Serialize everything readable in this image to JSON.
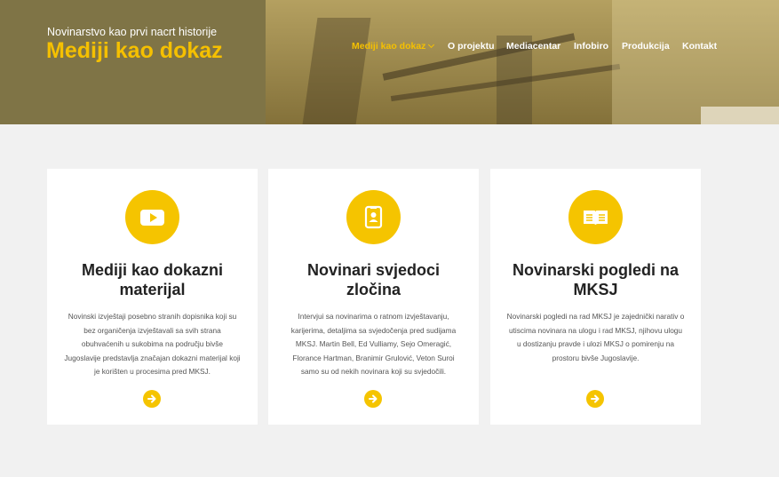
{
  "header": {
    "tagline": "Novinarstvo kao prvi nacrt historije",
    "title": "Mediji kao dokaz"
  },
  "nav": {
    "items": [
      {
        "label": "Mediji kao dokaz",
        "active": true,
        "has_dropdown": true
      },
      {
        "label": "O projektu"
      },
      {
        "label": "Mediacentar"
      },
      {
        "label": "Infobiro"
      },
      {
        "label": "Produkcija"
      },
      {
        "label": "Kontakt"
      }
    ]
  },
  "colors": {
    "accent": "#f5c400",
    "background": "#f1f1f1",
    "card": "#ffffff"
  },
  "cards": [
    {
      "icon": "video-play-icon",
      "title": "Mediji kao dokazni materijal",
      "text": "Novinski izvještaji posebno stranih dopisnika koji su bez organičenja izvještavali sa svih strana obuhvaćenih u sukobima na području bivše Jugoslavije predstavlja značajan dokazni materijal koji je korišten u procesima pred MKSJ."
    },
    {
      "icon": "id-badge-icon",
      "title": "Novinari svjedoci zločina",
      "text": "Intervjui sa novinarima o ratnom izvještavanju, karijerima, detaljima sa svjedočenja pred sudijama MKSJ. Martin Bell, Ed Vulliamy, Sejo Omeragić, Florance Hartman, Branimir Grulović, Veton Suroi samo su od nekih novinara koji su svjedočili."
    },
    {
      "icon": "open-book-icon",
      "title": "Novinarski pogledi na MKSJ",
      "text": "Novinarski pogledi na rad MKSJ je zajednički narativ o utiscima novinara na ulogu i rad MKSJ, njihovu ulogu u dostizanju pravde i ulozi MKSJ o pomirenju na prostoru bivše Jugoslavije."
    }
  ]
}
